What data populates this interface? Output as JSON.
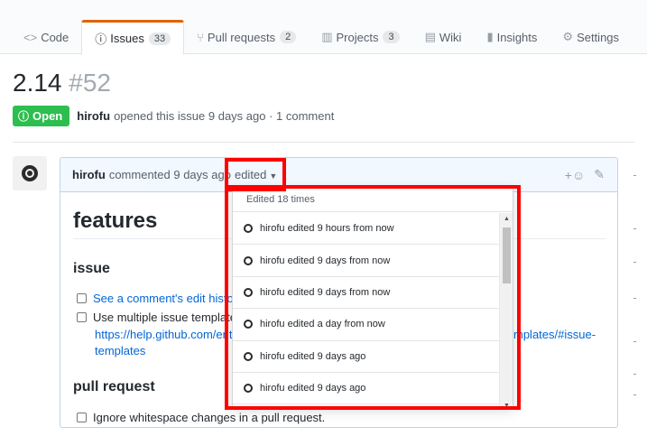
{
  "tabs": [
    {
      "icon": "code-icon",
      "glyph": "<>",
      "label": "Code",
      "counter": ""
    },
    {
      "icon": "issue-opened-icon",
      "glyph": "ⓘ",
      "label": "Issues",
      "counter": "33"
    },
    {
      "icon": "pull-request-icon",
      "glyph": "⑂",
      "label": "Pull requests",
      "counter": "2"
    },
    {
      "icon": "project-icon",
      "glyph": "▥",
      "label": "Projects",
      "counter": "3"
    },
    {
      "icon": "book-icon",
      "glyph": "▤",
      "label": "Wiki",
      "counter": ""
    },
    {
      "icon": "graph-icon",
      "glyph": "▮",
      "label": "Insights",
      "counter": ""
    },
    {
      "icon": "gear-icon",
      "glyph": "⚙",
      "label": "Settings",
      "counter": ""
    }
  ],
  "issue": {
    "title": "2.14",
    "number": "#52",
    "state": "Open",
    "author": "hirofu",
    "meta_text": "opened this issue 9 days ago · 1 comment"
  },
  "comment": {
    "author": "hirofu",
    "time_text": "commented 9 days ago",
    "edited_label": "edited",
    "reaction_glyph": "+☺",
    "edit_glyph": "✎",
    "body": {
      "h1": "features",
      "section1": "issue",
      "task1": "See a comment's edit history",
      "task2": "Use multiple issue templates",
      "url_part1": "https://help.github.com/ente",
      "url_part2": "mplates/#issue-",
      "url_part3": "templates",
      "section2": "pull request",
      "task3": "Ignore whitespace changes in a pull request."
    }
  },
  "history": {
    "header": "Edited 18 times",
    "items": [
      "hirofu edited 9 hours from now",
      "hirofu edited 9 days from now",
      "hirofu edited 9 days from now",
      "hirofu edited a day from now",
      "hirofu edited 9 days ago",
      "hirofu edited 9 days ago"
    ]
  },
  "colors": {
    "active_tab_accent": "#e36209",
    "open_state": "#2cbe4e",
    "link": "#0366d6",
    "highlight": "#ff0000"
  }
}
